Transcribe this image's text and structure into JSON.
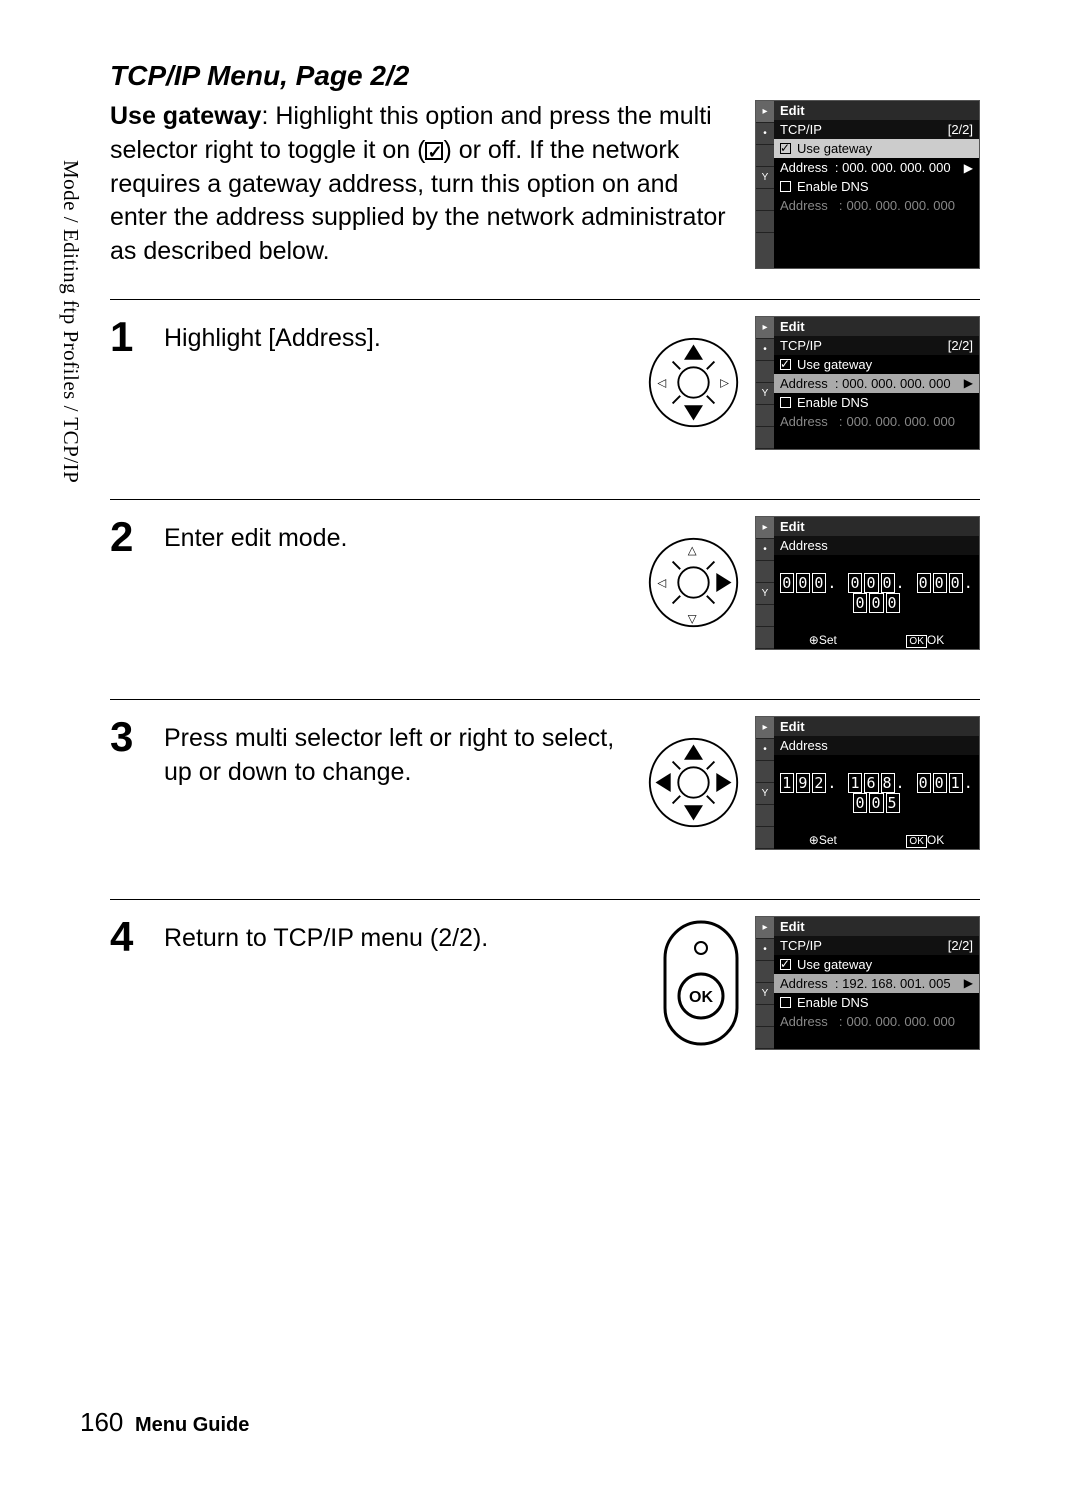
{
  "side_label": "Mode / Editing ftp Profiles / TCP/IP",
  "section_title": "TCP/IP Menu, Page 2/2",
  "intro": {
    "bold": "Use gateway",
    "rest": ": Highlight this option and press the multi selector right to toggle it on (",
    "rest2": ") or off.  If the network requires a gateway address, turn this option on and enter the address supplied by the network administrator as described below."
  },
  "steps": {
    "s1": {
      "num": "1",
      "text": "Highlight [Address]."
    },
    "s2": {
      "num": "2",
      "text": "Enter edit mode."
    },
    "s3": {
      "num": "3",
      "text": "Press multi selector left or right to select, up or down to change."
    },
    "s4": {
      "num": "4",
      "text": "Return to TCP/IP menu (2/2)."
    }
  },
  "screens": {
    "tcpip": {
      "edit": "Edit",
      "title": "TCP/IP",
      "page": "[2/2]",
      "use_gateway": "Use gateway",
      "address_lbl": "Address",
      "address_zero": "000. 000. 000. 000",
      "address_val": "192. 168. 001. 005",
      "enable_dns": "Enable DNS"
    },
    "address": {
      "edit": "Edit",
      "title": "Address",
      "zeros": [
        "0",
        "0",
        "0",
        ".",
        "0",
        "0",
        "0",
        ".",
        "0",
        "0",
        "0",
        ".",
        "0",
        "0",
        "0"
      ],
      "entered": [
        "1",
        "9",
        "2",
        ".",
        "1",
        "6",
        "8",
        ".",
        "0",
        "0",
        "1",
        ".",
        "0",
        "0",
        "5"
      ],
      "set": "Set",
      "ok": "OK"
    }
  },
  "footer": {
    "page": "160",
    "title": "Menu Guide"
  }
}
